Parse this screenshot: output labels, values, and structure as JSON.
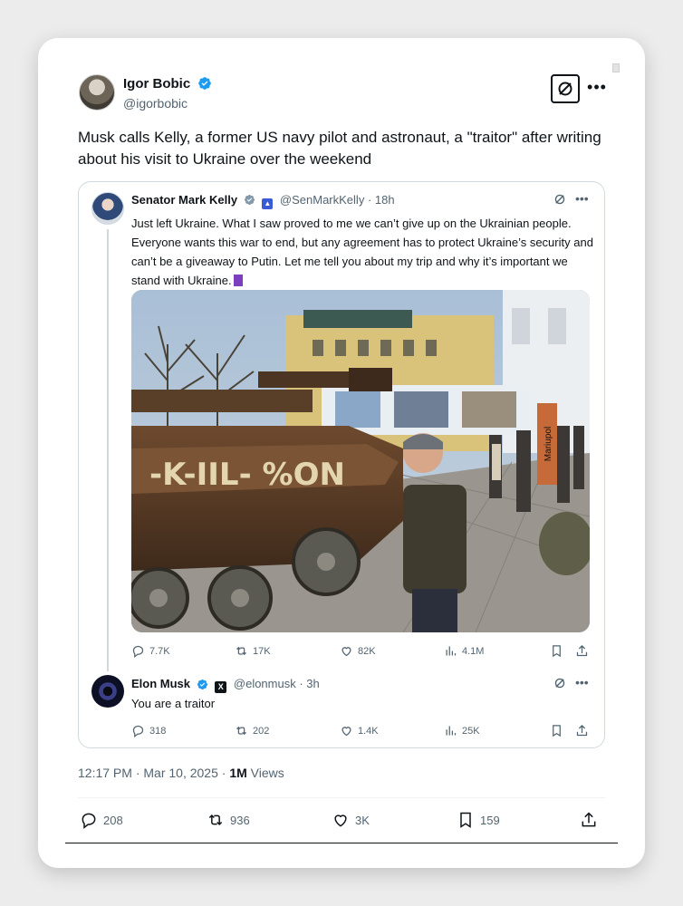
{
  "tweet": {
    "author_name": "Igor Bobic",
    "author_handle": "@igorbobic",
    "text": "Musk calls  Kelly, a former US navy pilot and astronaut, a \"traitor\" after writing about his visit to Ukraine over the weekend",
    "timestamp": "12:17 PM · Mar 10, 2025 · ",
    "views_count": "1M",
    "views_label": "Views",
    "stats": {
      "replies": "208",
      "reposts": "936",
      "likes": "3K",
      "bookmarks": "159"
    }
  },
  "quoted": {
    "author_name": "Senator Mark Kelly",
    "author_handle": "@SenMarkKelly",
    "time": "· 18h",
    "text": "Just left Ukraine. What I saw proved to me we can’t give up on the Ukrainian people. Everyone wants this war to end, but any agreement has to protect Ukraine’s security and can’t be a giveaway to Putin. Let me tell you about my trip and why it’s important we stand with Ukraine.",
    "photo_sign_text": "Mariupol",
    "stats": {
      "replies": "7.7K",
      "reposts": "17K",
      "likes": "82K",
      "views": "4.1M"
    }
  },
  "reply": {
    "author_name": "Elon Musk",
    "author_handle": "@elonmusk",
    "time": "· 3h",
    "text": "You are a traitor",
    "stats": {
      "replies": "318",
      "reposts": "202",
      "likes": "1.4K",
      "views": "25K"
    }
  },
  "colors": {
    "verified_blue": "#1d9bf0",
    "secondary_text": "#536471",
    "primary_text": "#0f1419",
    "border": "#cfd9de"
  },
  "icons": [
    "verified-badge-icon",
    "grok-icon",
    "more-icon",
    "reply-icon",
    "repost-icon",
    "like-icon",
    "views-icon",
    "bookmark-icon",
    "share-icon"
  ]
}
